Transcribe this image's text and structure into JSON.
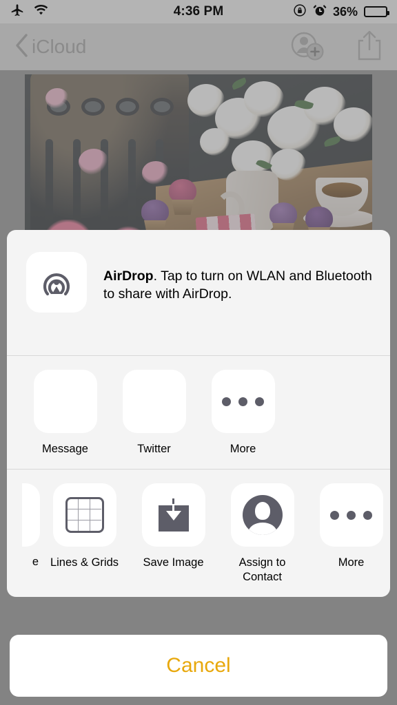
{
  "status_bar": {
    "airplane_icon": "airplane-mode-icon",
    "wifi_icon": "wifi-icon",
    "time": "4:36 PM",
    "rotation_lock_icon": "rotation-lock-icon",
    "alarm_icon": "alarm-clock-icon",
    "battery_percent": "36%",
    "battery_level": 36
  },
  "nav_bar": {
    "back_label": "iCloud",
    "back_icon": "chevron-left-icon",
    "add_person_icon": "add-person-icon",
    "share_icon": "share-icon"
  },
  "photo": {
    "description": "Dessert table with cupcakes, macarons, layered pink cake, teacup and white blossom branches"
  },
  "share_sheet": {
    "airdrop": {
      "icon": "airdrop-icon",
      "title": "AirDrop",
      "message": ". Tap to turn on WLAN and Bluetooth to share with AirDrop."
    },
    "app_row": [
      {
        "label": "Message",
        "icon": "messages-app-icon"
      },
      {
        "label": "Twitter",
        "icon": "twitter-app-icon"
      },
      {
        "label": "More",
        "icon": "more-dots-icon"
      }
    ],
    "action_row": {
      "partial_label": "e",
      "items": [
        {
          "label": "Lines & Grids",
          "icon": "grid-icon"
        },
        {
          "label": "Save Image",
          "icon": "save-image-icon"
        },
        {
          "label": "Assign to\nContact",
          "icon": "assign-contact-icon"
        },
        {
          "label": "More",
          "icon": "more-dots-icon"
        }
      ]
    }
  },
  "cancel": {
    "label": "Cancel"
  },
  "colors": {
    "cancel_text": "#e8a80c",
    "messages_green": "#2fd13a",
    "twitter_blue": "#1da1f2",
    "icon_gray": "#5d5d68",
    "sheet_bg": "#f4f4f4",
    "backdrop": "#8e8e8e"
  }
}
